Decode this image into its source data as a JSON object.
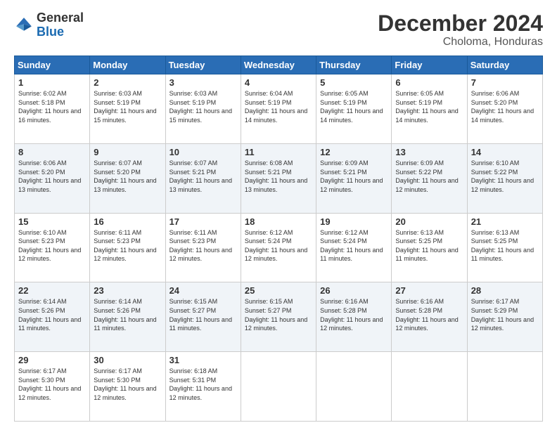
{
  "logo": {
    "text_general": "General",
    "text_blue": "Blue"
  },
  "header": {
    "month_title": "December 2024",
    "subtitle": "Choloma, Honduras"
  },
  "days_of_week": [
    "Sunday",
    "Monday",
    "Tuesday",
    "Wednesday",
    "Thursday",
    "Friday",
    "Saturday"
  ],
  "weeks": [
    [
      {
        "day": "1",
        "sunrise": "6:02 AM",
        "sunset": "5:18 PM",
        "daylight": "11 hours and 16 minutes."
      },
      {
        "day": "2",
        "sunrise": "6:03 AM",
        "sunset": "5:19 PM",
        "daylight": "11 hours and 15 minutes."
      },
      {
        "day": "3",
        "sunrise": "6:03 AM",
        "sunset": "5:19 PM",
        "daylight": "11 hours and 15 minutes."
      },
      {
        "day": "4",
        "sunrise": "6:04 AM",
        "sunset": "5:19 PM",
        "daylight": "11 hours and 14 minutes."
      },
      {
        "day": "5",
        "sunrise": "6:05 AM",
        "sunset": "5:19 PM",
        "daylight": "11 hours and 14 minutes."
      },
      {
        "day": "6",
        "sunrise": "6:05 AM",
        "sunset": "5:19 PM",
        "daylight": "11 hours and 14 minutes."
      },
      {
        "day": "7",
        "sunrise": "6:06 AM",
        "sunset": "5:20 PM",
        "daylight": "11 hours and 14 minutes."
      }
    ],
    [
      {
        "day": "8",
        "sunrise": "6:06 AM",
        "sunset": "5:20 PM",
        "daylight": "11 hours and 13 minutes."
      },
      {
        "day": "9",
        "sunrise": "6:07 AM",
        "sunset": "5:20 PM",
        "daylight": "11 hours and 13 minutes."
      },
      {
        "day": "10",
        "sunrise": "6:07 AM",
        "sunset": "5:21 PM",
        "daylight": "11 hours and 13 minutes."
      },
      {
        "day": "11",
        "sunrise": "6:08 AM",
        "sunset": "5:21 PM",
        "daylight": "11 hours and 13 minutes."
      },
      {
        "day": "12",
        "sunrise": "6:09 AM",
        "sunset": "5:21 PM",
        "daylight": "11 hours and 12 minutes."
      },
      {
        "day": "13",
        "sunrise": "6:09 AM",
        "sunset": "5:22 PM",
        "daylight": "11 hours and 12 minutes."
      },
      {
        "day": "14",
        "sunrise": "6:10 AM",
        "sunset": "5:22 PM",
        "daylight": "11 hours and 12 minutes."
      }
    ],
    [
      {
        "day": "15",
        "sunrise": "6:10 AM",
        "sunset": "5:23 PM",
        "daylight": "11 hours and 12 minutes."
      },
      {
        "day": "16",
        "sunrise": "6:11 AM",
        "sunset": "5:23 PM",
        "daylight": "11 hours and 12 minutes."
      },
      {
        "day": "17",
        "sunrise": "6:11 AM",
        "sunset": "5:23 PM",
        "daylight": "11 hours and 12 minutes."
      },
      {
        "day": "18",
        "sunrise": "6:12 AM",
        "sunset": "5:24 PM",
        "daylight": "11 hours and 12 minutes."
      },
      {
        "day": "19",
        "sunrise": "6:12 AM",
        "sunset": "5:24 PM",
        "daylight": "11 hours and 11 minutes."
      },
      {
        "day": "20",
        "sunrise": "6:13 AM",
        "sunset": "5:25 PM",
        "daylight": "11 hours and 11 minutes."
      },
      {
        "day": "21",
        "sunrise": "6:13 AM",
        "sunset": "5:25 PM",
        "daylight": "11 hours and 11 minutes."
      }
    ],
    [
      {
        "day": "22",
        "sunrise": "6:14 AM",
        "sunset": "5:26 PM",
        "daylight": "11 hours and 11 minutes."
      },
      {
        "day": "23",
        "sunrise": "6:14 AM",
        "sunset": "5:26 PM",
        "daylight": "11 hours and 11 minutes."
      },
      {
        "day": "24",
        "sunrise": "6:15 AM",
        "sunset": "5:27 PM",
        "daylight": "11 hours and 11 minutes."
      },
      {
        "day": "25",
        "sunrise": "6:15 AM",
        "sunset": "5:27 PM",
        "daylight": "11 hours and 12 minutes."
      },
      {
        "day": "26",
        "sunrise": "6:16 AM",
        "sunset": "5:28 PM",
        "daylight": "11 hours and 12 minutes."
      },
      {
        "day": "27",
        "sunrise": "6:16 AM",
        "sunset": "5:28 PM",
        "daylight": "11 hours and 12 minutes."
      },
      {
        "day": "28",
        "sunrise": "6:17 AM",
        "sunset": "5:29 PM",
        "daylight": "11 hours and 12 minutes."
      }
    ],
    [
      {
        "day": "29",
        "sunrise": "6:17 AM",
        "sunset": "5:30 PM",
        "daylight": "11 hours and 12 minutes."
      },
      {
        "day": "30",
        "sunrise": "6:17 AM",
        "sunset": "5:30 PM",
        "daylight": "11 hours and 12 minutes."
      },
      {
        "day": "31",
        "sunrise": "6:18 AM",
        "sunset": "5:31 PM",
        "daylight": "11 hours and 12 minutes."
      },
      null,
      null,
      null,
      null
    ]
  ]
}
